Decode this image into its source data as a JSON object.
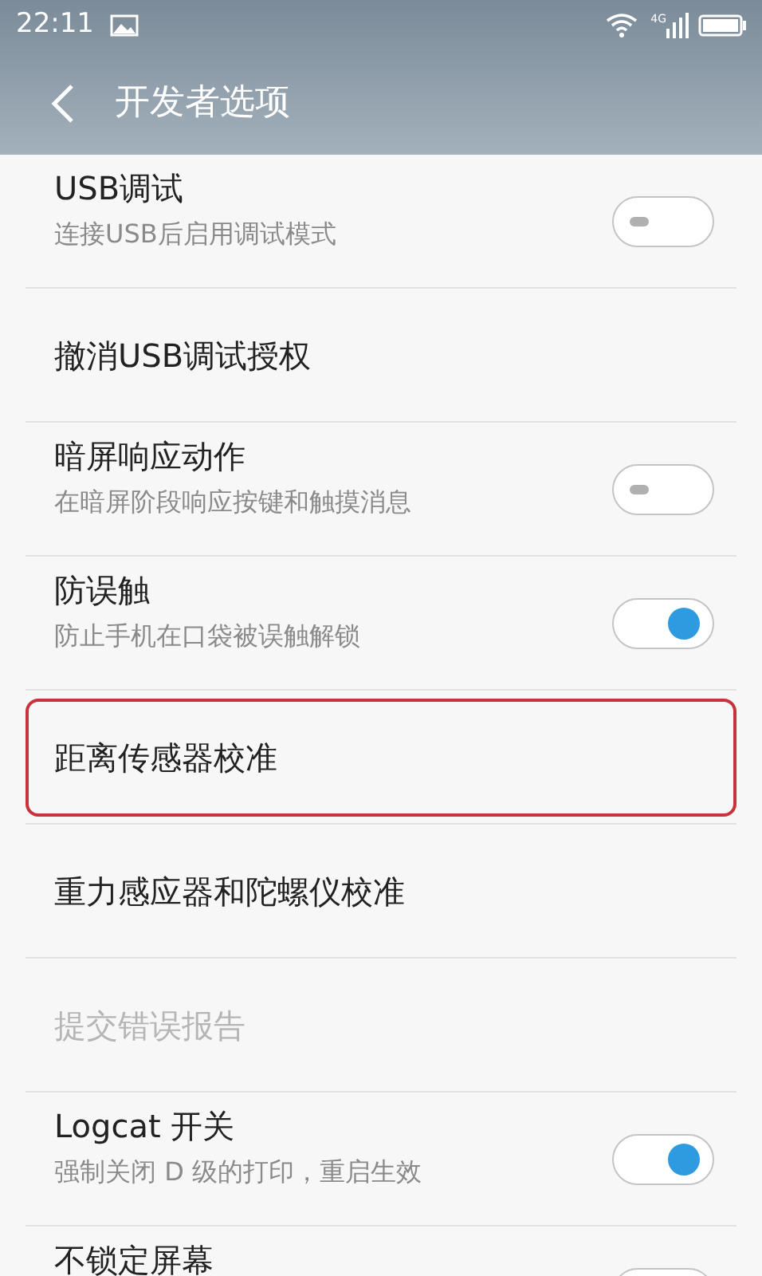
{
  "status_bar": {
    "time": "22:11",
    "network": "4G"
  },
  "header": {
    "title": "开发者选项"
  },
  "items": [
    {
      "kind": "switch",
      "title": "USB调试",
      "subtitle": "连接USB后启用调试模式",
      "on": false,
      "disabled": false,
      "highlighted": false
    },
    {
      "kind": "action",
      "title": "撤消USB调试授权",
      "disabled": false,
      "highlighted": false
    },
    {
      "kind": "switch",
      "title": "暗屏响应动作",
      "subtitle": "在暗屏阶段响应按键和触摸消息",
      "on": false,
      "disabled": false,
      "highlighted": false
    },
    {
      "kind": "switch",
      "title": "防误触",
      "subtitle": "防止手机在口袋被误触解锁",
      "on": true,
      "disabled": false,
      "highlighted": false
    },
    {
      "kind": "action",
      "title": "距离传感器校准",
      "disabled": false,
      "highlighted": true
    },
    {
      "kind": "action",
      "title": "重力感应器和陀螺仪校准",
      "disabled": false,
      "highlighted": false
    },
    {
      "kind": "action",
      "title": "提交错误报告",
      "disabled": true,
      "highlighted": false
    },
    {
      "kind": "switch",
      "title": "Logcat 开关",
      "subtitle": "强制关闭 D 级的打印，重启生效",
      "on": true,
      "disabled": false,
      "highlighted": false
    },
    {
      "kind": "switch",
      "title": "不锁定屏幕",
      "disabled": false,
      "highlighted": false
    }
  ]
}
